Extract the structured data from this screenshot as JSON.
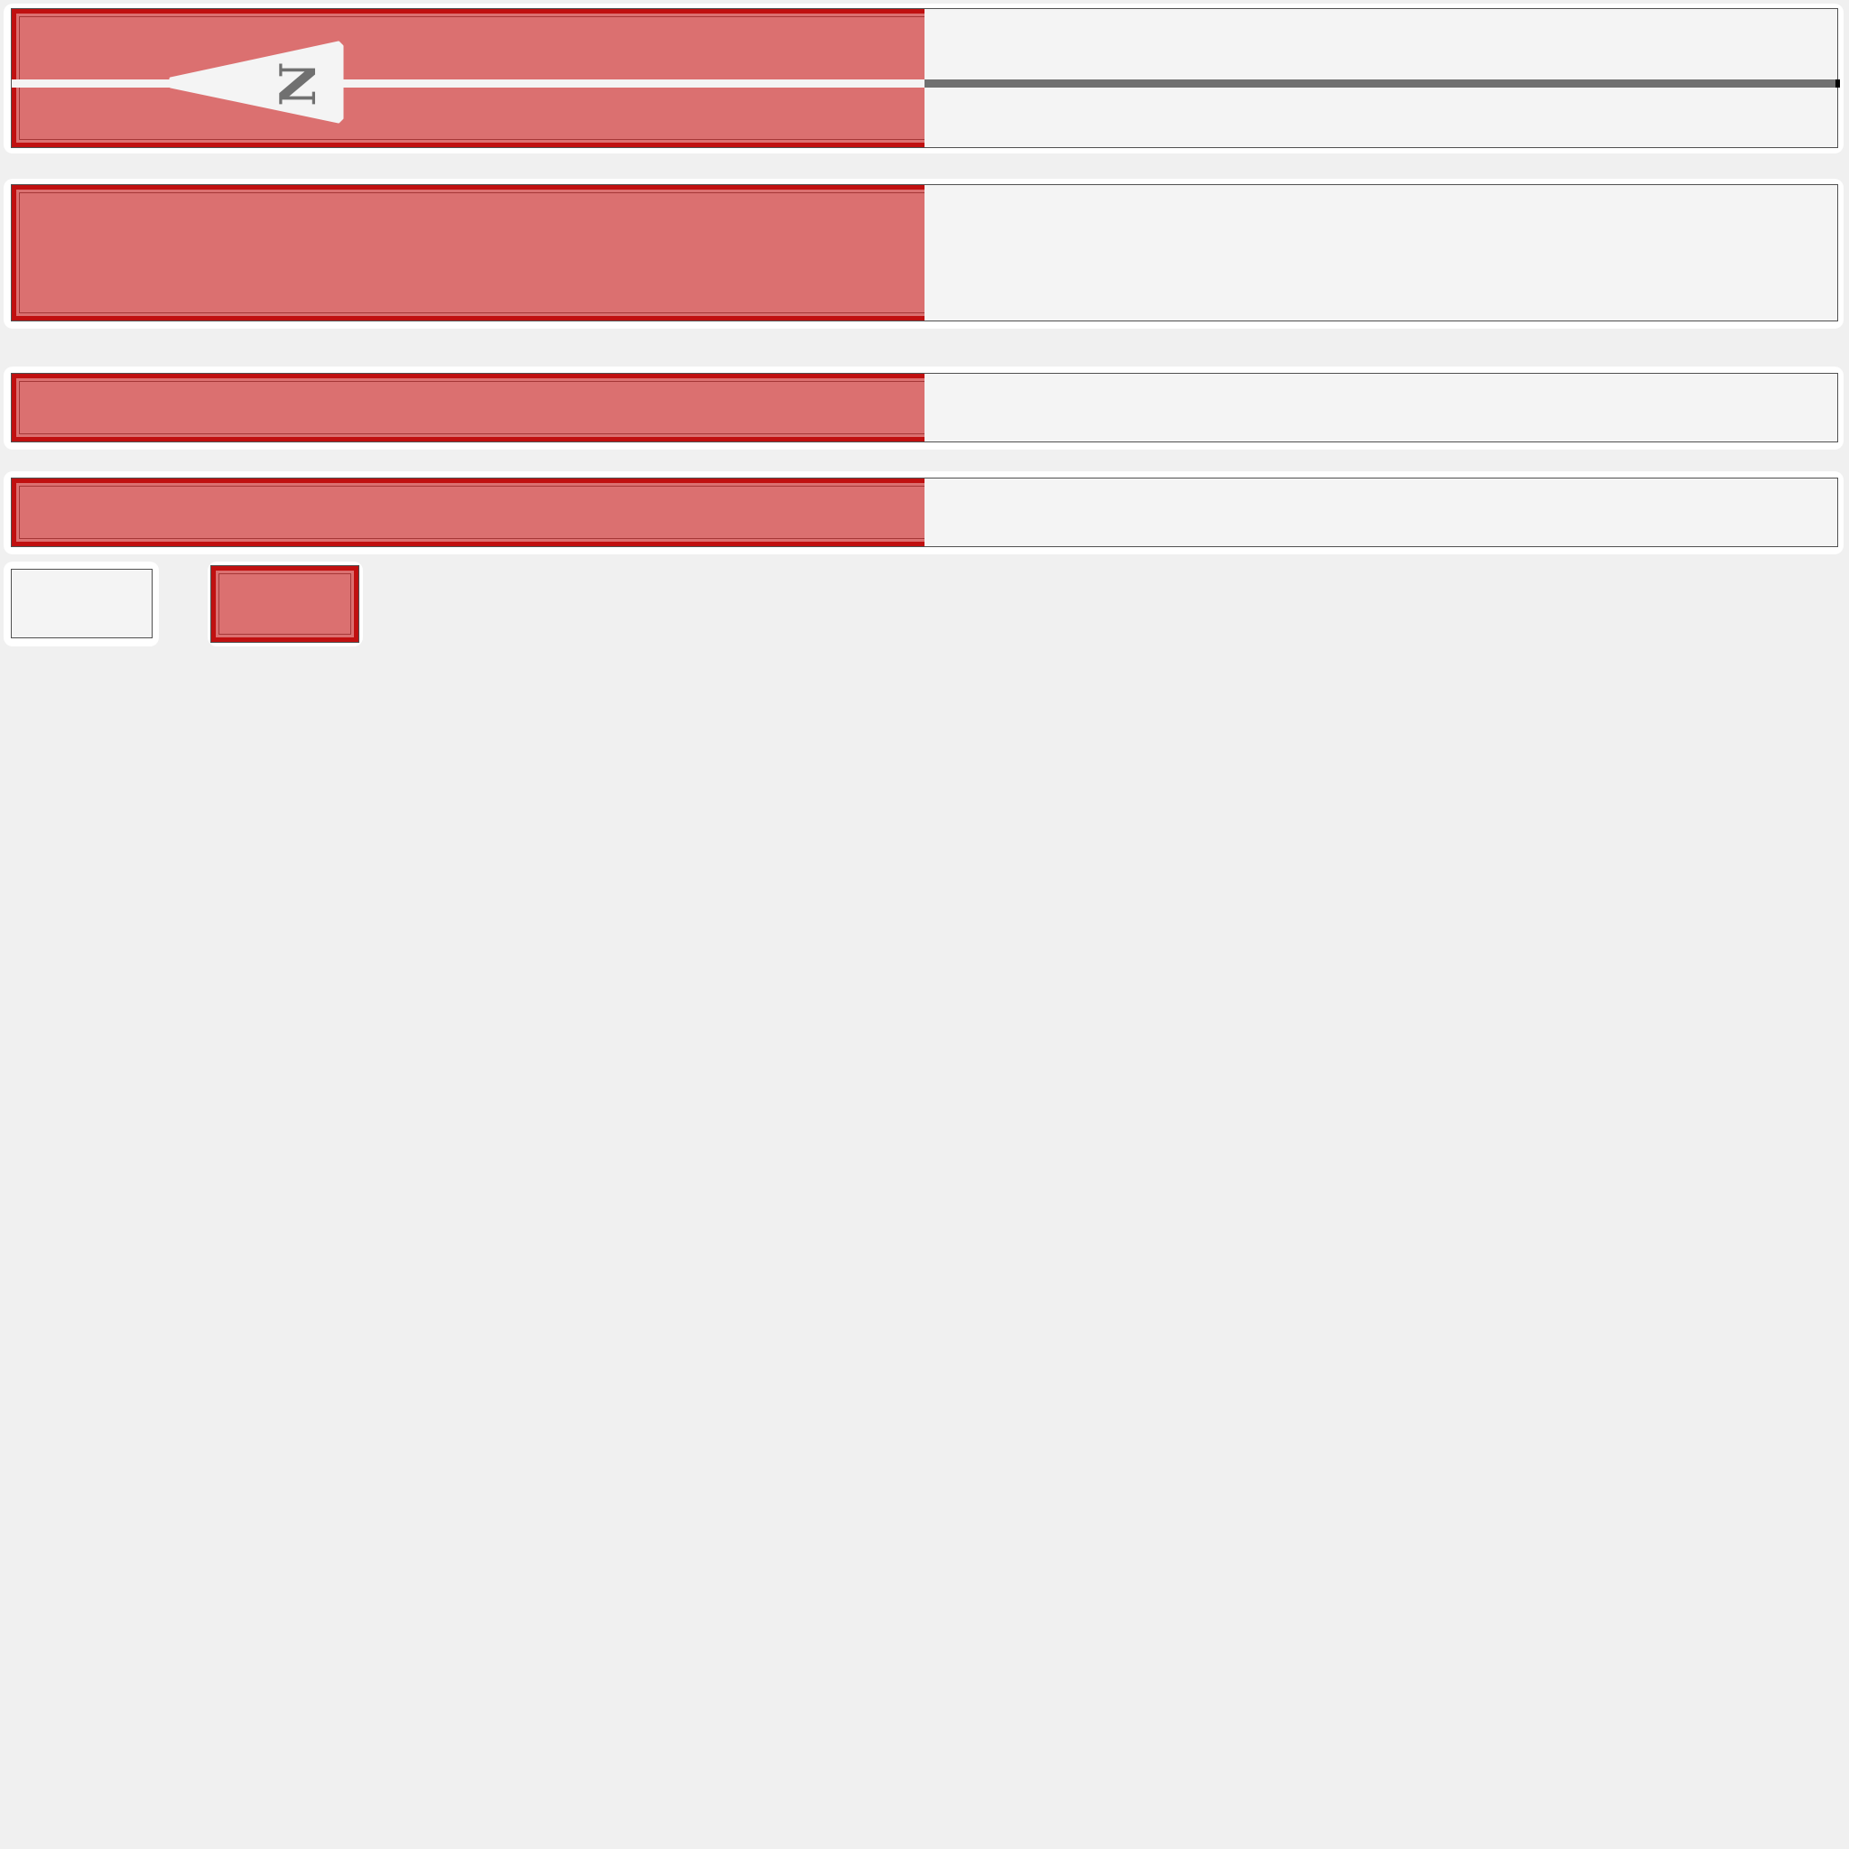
{
  "theme": {
    "background": "#f0f0f0",
    "field_background": "#f4f4f4",
    "highlight_fill": "#dc6f6f",
    "highlight_border": "#c01010",
    "track_color": "#707070"
  },
  "slider": {
    "pointer_label": "N",
    "pointer_icon": "north-arrow-icon",
    "level_percent": 50
  },
  "bars": [
    {
      "level_percent": 50
    },
    {
      "level_percent": 50
    },
    {
      "level_percent": 50
    }
  ],
  "swatches": [
    {
      "state": "unselected"
    },
    {
      "state": "selected"
    }
  ]
}
